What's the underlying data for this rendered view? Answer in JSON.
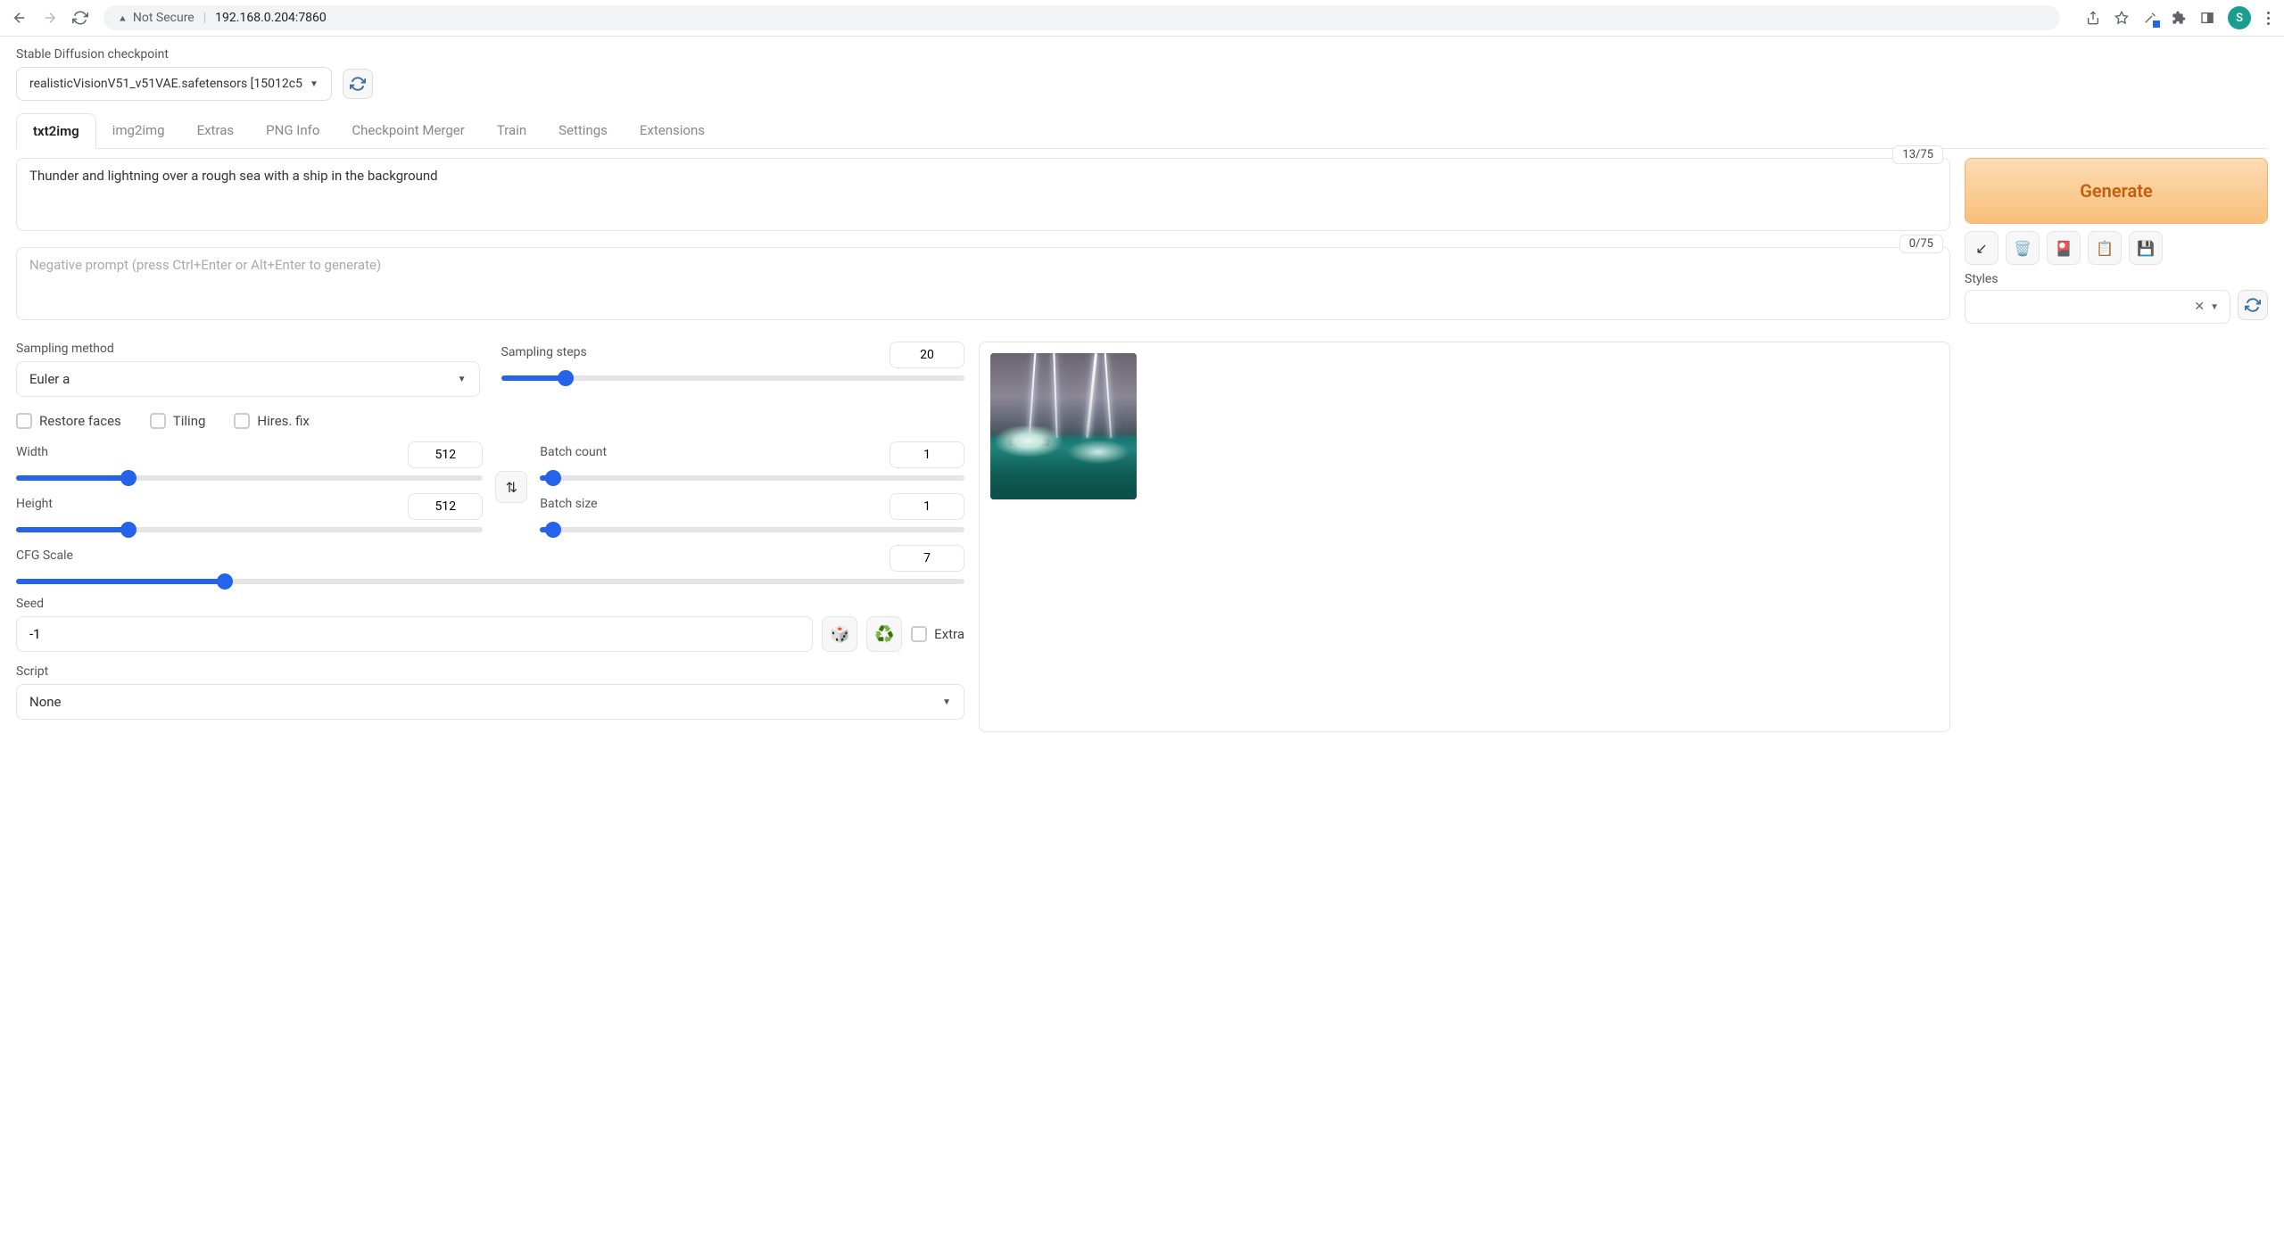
{
  "browser": {
    "not_secure": "Not Secure",
    "url": "192.168.0.204:7860",
    "avatar_letter": "S"
  },
  "checkpoint": {
    "label": "Stable Diffusion checkpoint",
    "value": "realisticVisionV51_v51VAE.safetensors [15012c5"
  },
  "tabs": [
    "txt2img",
    "img2img",
    "Extras",
    "PNG Info",
    "Checkpoint Merger",
    "Train",
    "Settings",
    "Extensions"
  ],
  "active_tab": 0,
  "prompt": {
    "value": "Thunder and lightning over a rough sea with a ship in the background",
    "token_count": "13/75"
  },
  "negative": {
    "placeholder": "Negative prompt (press Ctrl+Enter or Alt+Enter to generate)",
    "token_count": "0/75"
  },
  "generate_label": "Generate",
  "styles_label": "Styles",
  "sampling": {
    "method_label": "Sampling method",
    "method_value": "Euler a",
    "steps_label": "Sampling steps",
    "steps_value": "20"
  },
  "checkboxes": {
    "restore": "Restore faces",
    "tiling": "Tiling",
    "hires": "Hires. fix"
  },
  "dims": {
    "width_label": "Width",
    "width_value": "512",
    "height_label": "Height",
    "height_value": "512"
  },
  "batch": {
    "count_label": "Batch count",
    "count_value": "1",
    "size_label": "Batch size",
    "size_value": "1"
  },
  "cfg": {
    "label": "CFG Scale",
    "value": "7"
  },
  "seed": {
    "label": "Seed",
    "value": "-1",
    "extra_label": "Extra"
  },
  "script": {
    "label": "Script",
    "value": "None"
  }
}
